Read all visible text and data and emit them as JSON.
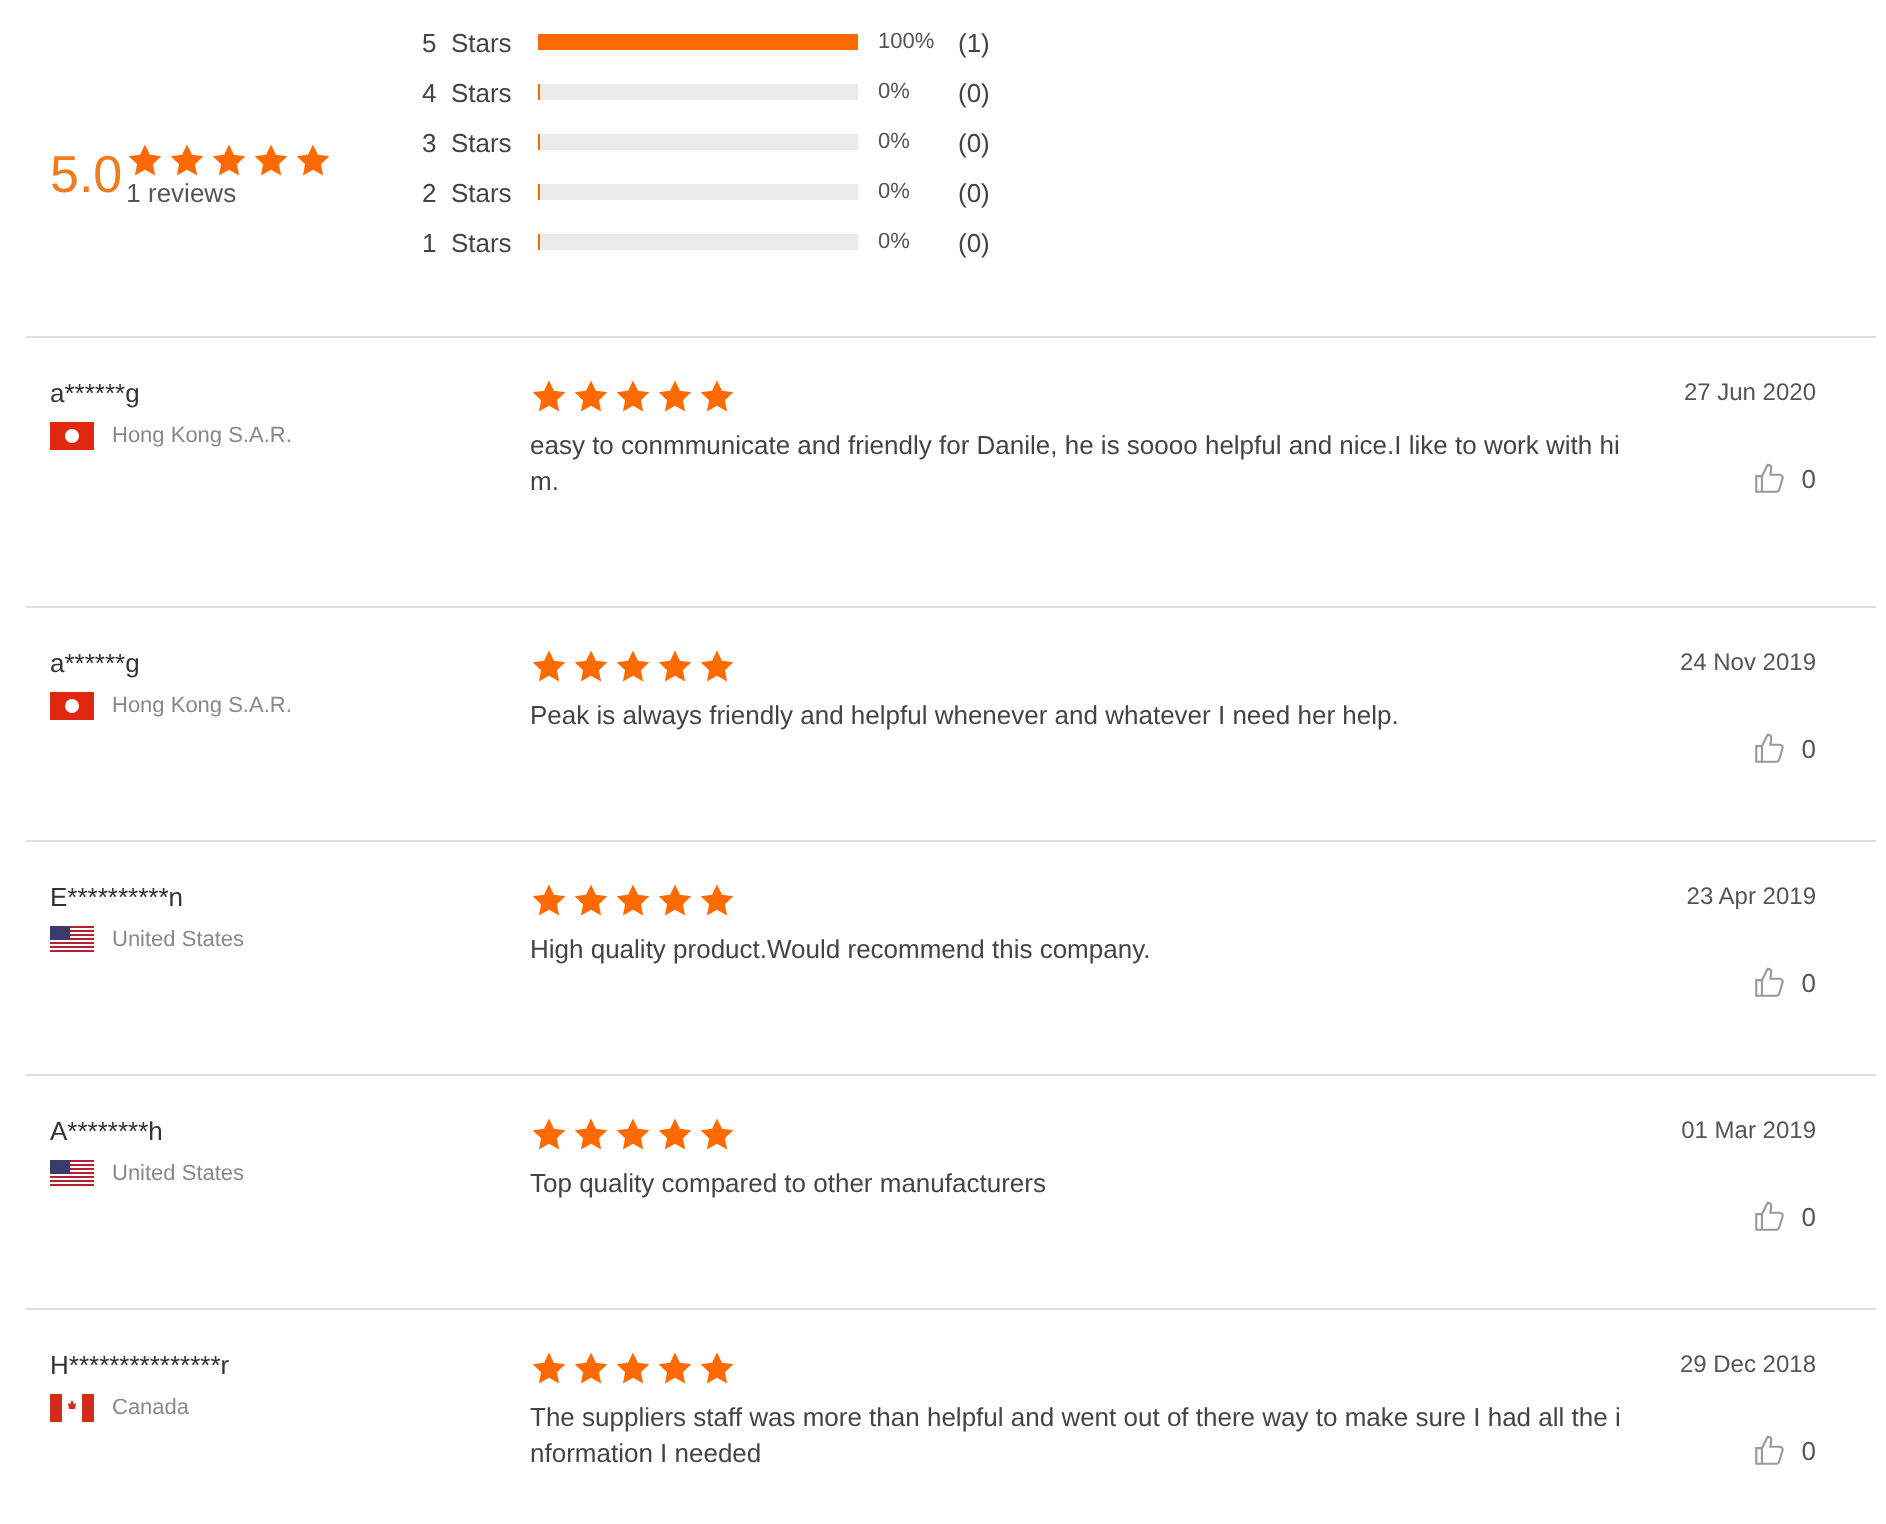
{
  "summary": {
    "score": "5.0",
    "stars": 5,
    "count": "1 reviews"
  },
  "distribution": [
    {
      "label": "5  Stars",
      "level": 1,
      "percent": "100%",
      "count": "(1)"
    },
    {
      "label": "4  Stars",
      "level": 0,
      "percent": "0%",
      "count": "(0)"
    },
    {
      "label": "3  Stars",
      "level": 0,
      "percent": "0%",
      "count": "(0)"
    },
    {
      "label": "2  Stars",
      "level": 0,
      "percent": "0%",
      "count": "(0)"
    },
    {
      "label": "1  Stars",
      "level": 0,
      "percent": "0%",
      "count": "(0)"
    }
  ],
  "reviews": [
    {
      "name": "a******g",
      "kind": "hk",
      "country": "Hong Kong S.A.R.",
      "stars": 5,
      "text": "easy to conmmunicate and friendly for Danile, he is soooo helpful and nice.I like to work with him.",
      "date": "27 Jun 2020",
      "likes": "0"
    },
    {
      "name": "a******g",
      "kind": "hk",
      "country": "Hong Kong S.A.R.",
      "stars": 5,
      "text": "Peak is always friendly and helpful whenever and whatever I need her help.",
      "date": "24 Nov 2019",
      "likes": "0"
    },
    {
      "name": "E**********n",
      "kind": "us",
      "country": "United States",
      "stars": 5,
      "text": "High quality product.Would recommend this company.",
      "date": "23 Apr 2019",
      "likes": "0"
    },
    {
      "name": "A********h",
      "kind": "us",
      "country": "United States",
      "stars": 5,
      "text": "Top quality compared to other manufacturers",
      "date": "01 Mar 2019",
      "likes": "0"
    },
    {
      "name": "H***************r",
      "kind": "ca",
      "country": "Canada",
      "stars": 5,
      "text": "The suppliers staff was more than helpful and went out of there way to make sure I had all the information I needed",
      "date": "29 Dec 2018",
      "likes": "0"
    }
  ]
}
